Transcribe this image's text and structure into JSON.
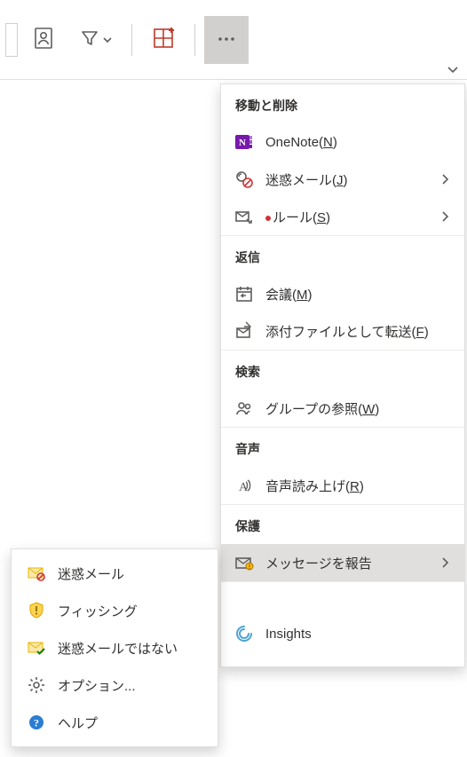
{
  "menu": {
    "sections": {
      "move_delete": {
        "title": "移動と削除"
      },
      "reply": {
        "title": "返信"
      },
      "search": {
        "title": "検索"
      },
      "voice": {
        "title": "音声"
      },
      "protect": {
        "title": "保護"
      }
    },
    "items": {
      "onenote": {
        "label_pre": "OneNote(",
        "hotkey": "N",
        "label_post": ")"
      },
      "junk": {
        "label_pre": "迷惑メール(",
        "hotkey": "J",
        "label_post": ")"
      },
      "rules": {
        "label_pre": "ルール(",
        "hotkey": "S",
        "label_post": ")"
      },
      "meeting": {
        "label_pre": "会議(",
        "hotkey": "M",
        "label_post": ")"
      },
      "fwd_attach": {
        "label_pre": "添付ファイルとして転送(",
        "hotkey": "F",
        "label_post": ")"
      },
      "browse_groups": {
        "label_pre": "グループの参照(",
        "hotkey": "W",
        "label_post": ")"
      },
      "read_aloud": {
        "label_pre": "音声読み上げ(",
        "hotkey": "R",
        "label_post": ")"
      },
      "report_message": {
        "label": "メッセージを報告"
      },
      "insights": {
        "label": "Insights"
      }
    }
  },
  "report_submenu": {
    "junk": {
      "label": "迷惑メール"
    },
    "phishing": {
      "label": "フィッシング"
    },
    "not_junk": {
      "label": "迷惑メールではない"
    },
    "options": {
      "label": "オプション..."
    },
    "help": {
      "label": "ヘルプ"
    }
  }
}
